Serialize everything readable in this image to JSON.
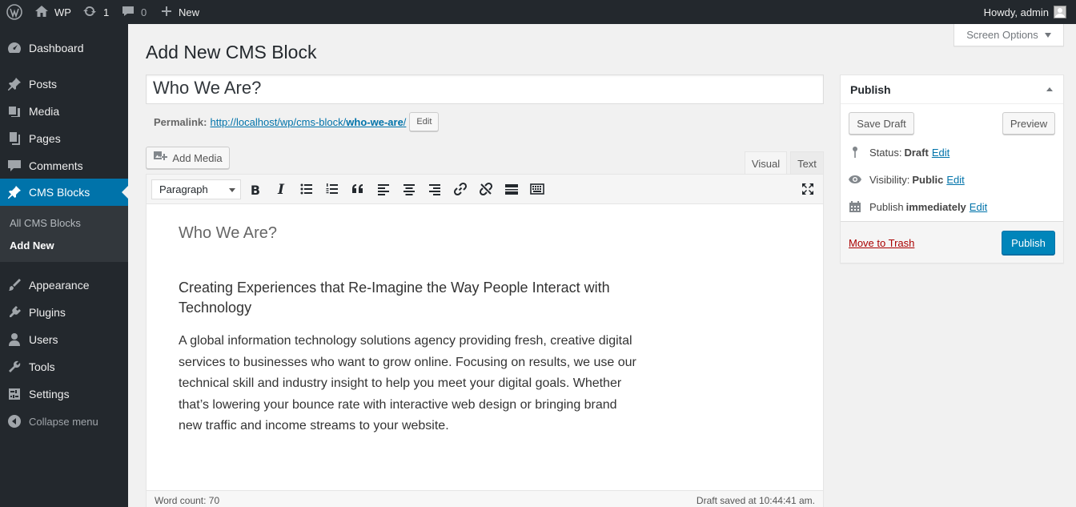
{
  "admin_bar": {
    "site_name": "WP",
    "updates_count": "1",
    "comments_count": "0",
    "new_label": "New",
    "howdy": "Howdy, admin"
  },
  "sidebar": {
    "items": [
      {
        "label": "Dashboard",
        "icon": "dashboard-icon"
      },
      {
        "label": "Posts",
        "icon": "pin-icon"
      },
      {
        "label": "Media",
        "icon": "media-icon"
      },
      {
        "label": "Pages",
        "icon": "pages-icon"
      },
      {
        "label": "Comments",
        "icon": "comments-icon"
      },
      {
        "label": "CMS Blocks",
        "icon": "pin-icon"
      },
      {
        "label": "Appearance",
        "icon": "brush-icon"
      },
      {
        "label": "Plugins",
        "icon": "plugin-icon"
      },
      {
        "label": "Users",
        "icon": "users-icon"
      },
      {
        "label": "Tools",
        "icon": "wrench-icon"
      },
      {
        "label": "Settings",
        "icon": "settings-icon"
      }
    ],
    "submenu": [
      "All CMS Blocks",
      "Add New"
    ],
    "collapse": "Collapse menu"
  },
  "screen_options": "Screen Options",
  "page": {
    "title": "Add New CMS Block",
    "post_title": "Who We Are?",
    "permalink_label": "Permalink:",
    "permalink_url": "http://localhost/wp/cms-block/",
    "permalink_slug": "who-we-are",
    "permalink_edit": "Edit"
  },
  "editor": {
    "add_media": "Add Media",
    "tab_visual": "Visual",
    "tab_text": "Text",
    "format": "Paragraph",
    "heading_main": "Who We Are?",
    "heading_sub": "Creating Experiences that Re-Imagine the Way People Interact with Technology",
    "body": "A global information technology solutions agency providing fresh, creative digital services to businesses who want to grow online. Focusing on results, we use our technical skill and industry insight to help you meet your digital goals. Whether that’s lowering your bounce rate with interactive web design or bringing brand new traffic and income streams to your website.",
    "word_count": "Word count: 70",
    "draft_saved": "Draft saved at 10:44:41 am."
  },
  "publish": {
    "title": "Publish",
    "save_draft": "Save Draft",
    "preview": "Preview",
    "status_label": "Status:",
    "status_value": "Draft",
    "visibility_label": "Visibility:",
    "visibility_value": "Public",
    "schedule_label": "Publish",
    "schedule_value": "immediately",
    "edit": "Edit",
    "trash": "Move to Trash",
    "publish_btn": "Publish"
  },
  "colors": {
    "admin_dark": "#23282d",
    "accent": "#0073aa",
    "primary_button": "#0085ba",
    "trash": "#a00"
  }
}
